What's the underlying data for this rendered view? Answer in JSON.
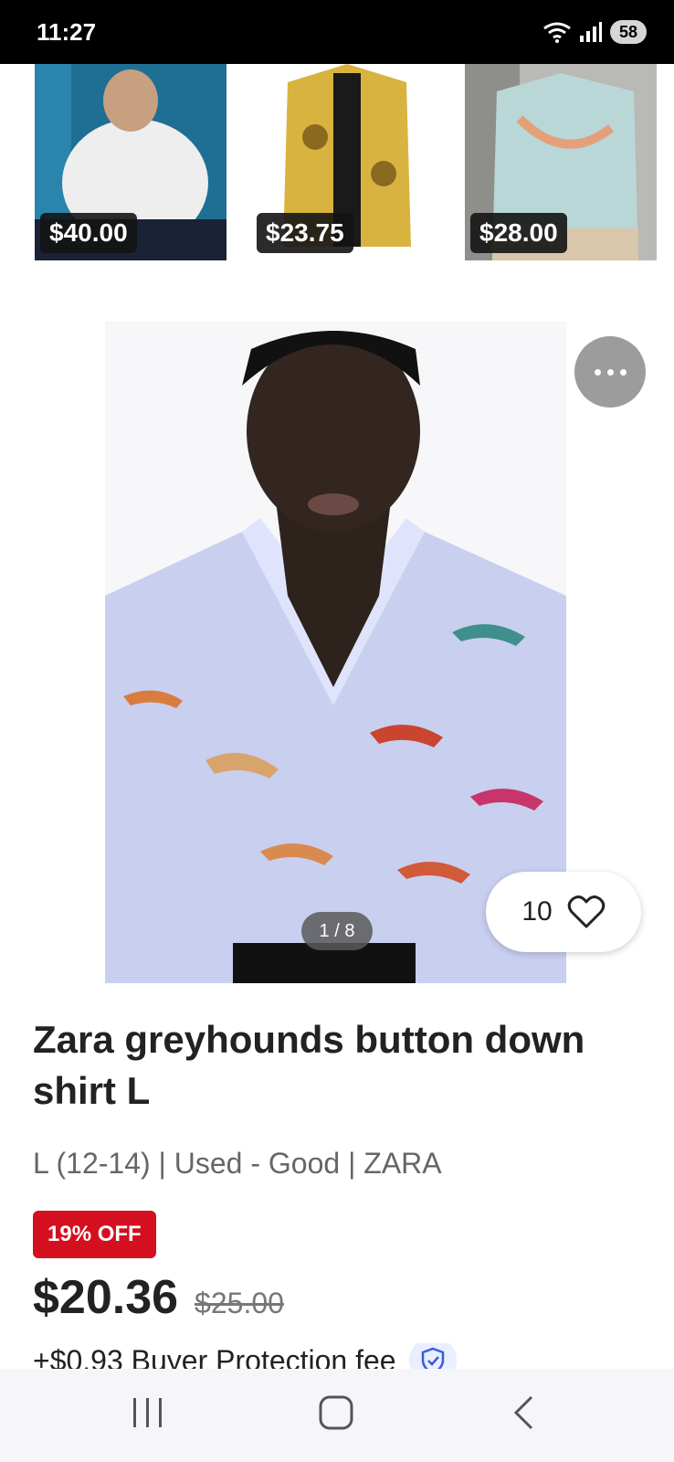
{
  "status_bar": {
    "time": "11:27",
    "battery": "58",
    "icons": [
      "wifi-icon",
      "signal-icon",
      "battery-icon"
    ]
  },
  "related_items": [
    {
      "price": "$40.00"
    },
    {
      "price": "$23.75"
    },
    {
      "price": "$28.00"
    }
  ],
  "gallery": {
    "counter": "1 / 8"
  },
  "likes": {
    "count": "10"
  },
  "product": {
    "title": "Zara greyhounds button down shirt L",
    "meta": "L (12-14) | Used - Good | ZARA",
    "discount_badge": "19% OFF",
    "price": "$20.36",
    "original_price": "$25.00",
    "buyer_protection": "+$0.93 Buyer Protection fee"
  },
  "colors": {
    "accent_red": "#d40f1f",
    "shield_blue": "#3b5bdb"
  },
  "nav": {
    "icons": [
      "recent-apps-icon",
      "home-icon",
      "back-icon"
    ]
  }
}
